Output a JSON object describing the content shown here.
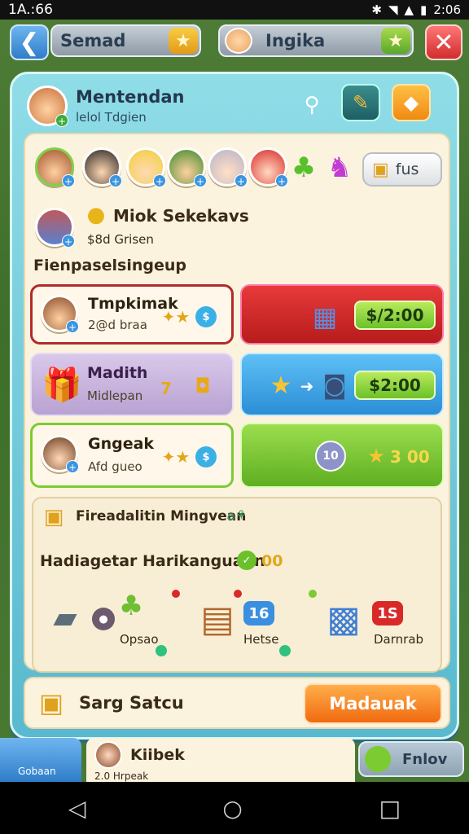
{
  "status_bar": {
    "time_left": "1A.:66",
    "time_right": "2:06"
  },
  "top_bar": {
    "tab1_label": "Semad",
    "tab2_label": "Ingika"
  },
  "header": {
    "name": "Mentendan",
    "subtitle": "lelol Tdgien"
  },
  "avatars_row": {
    "fus_label": "fus"
  },
  "player": {
    "name": "Miok Sekekavs",
    "sub": "$8d Grisen"
  },
  "section_title": "Fienpaselsingeup",
  "offers": [
    {
      "name": "Tmpkimak",
      "sub": "2@d braa",
      "price": "$/2:00"
    },
    {
      "name": "Madith",
      "sub": "Midlepan",
      "count": "7",
      "price": "$2:00"
    },
    {
      "name": "Gngeak",
      "sub": "Afd gueo",
      "price": "3 00"
    }
  ],
  "rewards": {
    "title": "Fireadalitin Mingvean",
    "subtitle": "Hadiagetar Harikanguahn",
    "subtitle_value": "00",
    "items": [
      {
        "label": "Opsao"
      },
      {
        "label": "Hetse",
        "badge": "16"
      },
      {
        "label": "Darnrab",
        "badge": "1S"
      }
    ]
  },
  "footer": {
    "label": "Sarg Satcu",
    "action_label": "Madauak"
  },
  "bottom_strip": {
    "name": "Kiibek",
    "sub": "2.0 Hrpeak",
    "left_label": "Gobaan",
    "right_label": "Fnlov"
  },
  "colors": {
    "panel": "#59b9cf",
    "cream": "#fbf3de",
    "red": "#d7232b",
    "purple": "#c8b3dd",
    "blue": "#3aa2e6",
    "green": "#7ccb32",
    "orange": "#f06a10"
  }
}
